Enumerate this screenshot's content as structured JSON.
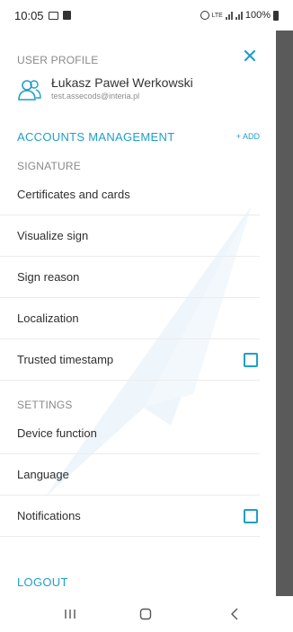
{
  "status_bar": {
    "time": "10:05",
    "network": "LTE",
    "battery": "100%"
  },
  "drawer": {
    "user_profile_label": "USER PROFILE",
    "user_name": "Łukasz Paweł Werkowski",
    "user_email": "test.assecods@interia.pl",
    "accounts_title": "ACCOUNTS MANAGEMENT",
    "add_label": "+ ADD",
    "signature_label": "SIGNATURE",
    "signature_items": [
      {
        "label": "Certificates and cards"
      },
      {
        "label": "Visualize sign"
      },
      {
        "label": "Sign reason"
      },
      {
        "label": "Localization"
      },
      {
        "label": "Trusted timestamp",
        "checked": false
      }
    ],
    "settings_label": "SETTINGS",
    "settings_items": [
      {
        "label": "Device function"
      },
      {
        "label": "Language"
      },
      {
        "label": "Notifications",
        "checked": false
      }
    ],
    "logout_label": "LOGOUT"
  },
  "colors": {
    "accent": "#1f9fc9",
    "scrim": "#5a5a5a",
    "divider": "#ececec"
  },
  "icons": {
    "close": "close-icon",
    "avatar": "users-icon",
    "nav_recent": "recent-apps-icon",
    "nav_home": "home-icon",
    "nav_back": "back-icon"
  }
}
